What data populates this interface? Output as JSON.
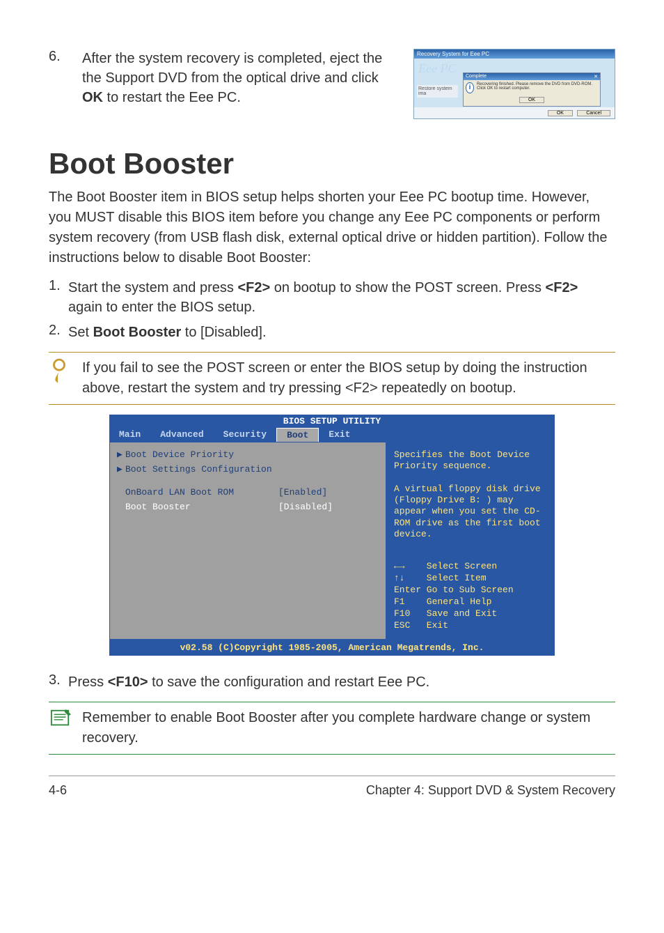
{
  "intro_step": {
    "num": "6.",
    "text_before": "After the system recovery is completed, eject the the Support DVD from the optical drive and click ",
    "bold": "OK",
    "text_after": " to restart the Eee PC."
  },
  "win": {
    "title": "Recovery System for Eee PC",
    "logo": "Eee PC",
    "sidebar": "Restore system ima",
    "dlg_title": "Complete",
    "dlg_close": "✕",
    "dlg_msg": "Recovering finished. Please remove the DVD from DVD-ROM. Click OK to restart computer.",
    "dlg_ok": "OK",
    "btn_ok": "OK",
    "btn_cancel": "Cancel"
  },
  "heading": "Boot Booster",
  "para1": "The Boot Booster item in BIOS setup helps shorten your Eee PC bootup time. However, you MUST disable this BIOS item before you change any Eee PC components or perform system recovery (from USB flash disk, external optical drive or hidden partition). Follow the instructions below to disable Boot Booster:",
  "step1": {
    "num": "1.",
    "t1": "Start the system and press ",
    "b1": "<F2>",
    "t2": " on bootup to show the POST screen. Press ",
    "b2": "<F2>",
    "t3": " again to enter the BIOS setup."
  },
  "step2": {
    "num": "2.",
    "t1": "Set ",
    "b1": "Boot Booster",
    "t2": " to [Disabled]."
  },
  "note1": "If you fail to see the POST screen or enter the BIOS setup by doing the instruction above, restart the system and try pressing <F2> repeatedly on bootup.",
  "bios": {
    "title": "BIOS SETUP UTILITY",
    "tabs": [
      "Main",
      "Advanced",
      "Security",
      "Boot",
      "Exit"
    ],
    "items": [
      {
        "arrow": "▶",
        "label": "Boot Device Priority",
        "val": ""
      },
      {
        "arrow": "▶",
        "label": "Boot Settings Configuration",
        "val": ""
      },
      {
        "arrow": "",
        "label": "OnBoard LAN Boot ROM",
        "val": "[Enabled]"
      },
      {
        "arrow": "",
        "label": "Boot Booster",
        "val": "[Disabled]",
        "sel": true
      }
    ],
    "help": "Specifies the Boot Device Priority sequence.\n\nA virtual floppy disk drive (Floppy Drive B: ) may appear when you set the CD-ROM drive as the first boot device.",
    "keys": [
      "←→    Select Screen",
      "↑↓    Select Item",
      "Enter Go to Sub Screen",
      "F1    General Help",
      "F10   Save and Exit",
      "ESC   Exit"
    ],
    "footer": "v02.58 (C)Copyright 1985-2005, American Megatrends, Inc."
  },
  "step3": {
    "num": "3.",
    "t1": "Press ",
    "b1": "<F10>",
    "t2": " to save the configuration and restart Eee PC."
  },
  "note2": "Remember to enable Boot Booster after you complete hardware change or system recovery.",
  "footer": {
    "left": "4-6",
    "right": "Chapter 4: Support DVD & System Recovery"
  }
}
